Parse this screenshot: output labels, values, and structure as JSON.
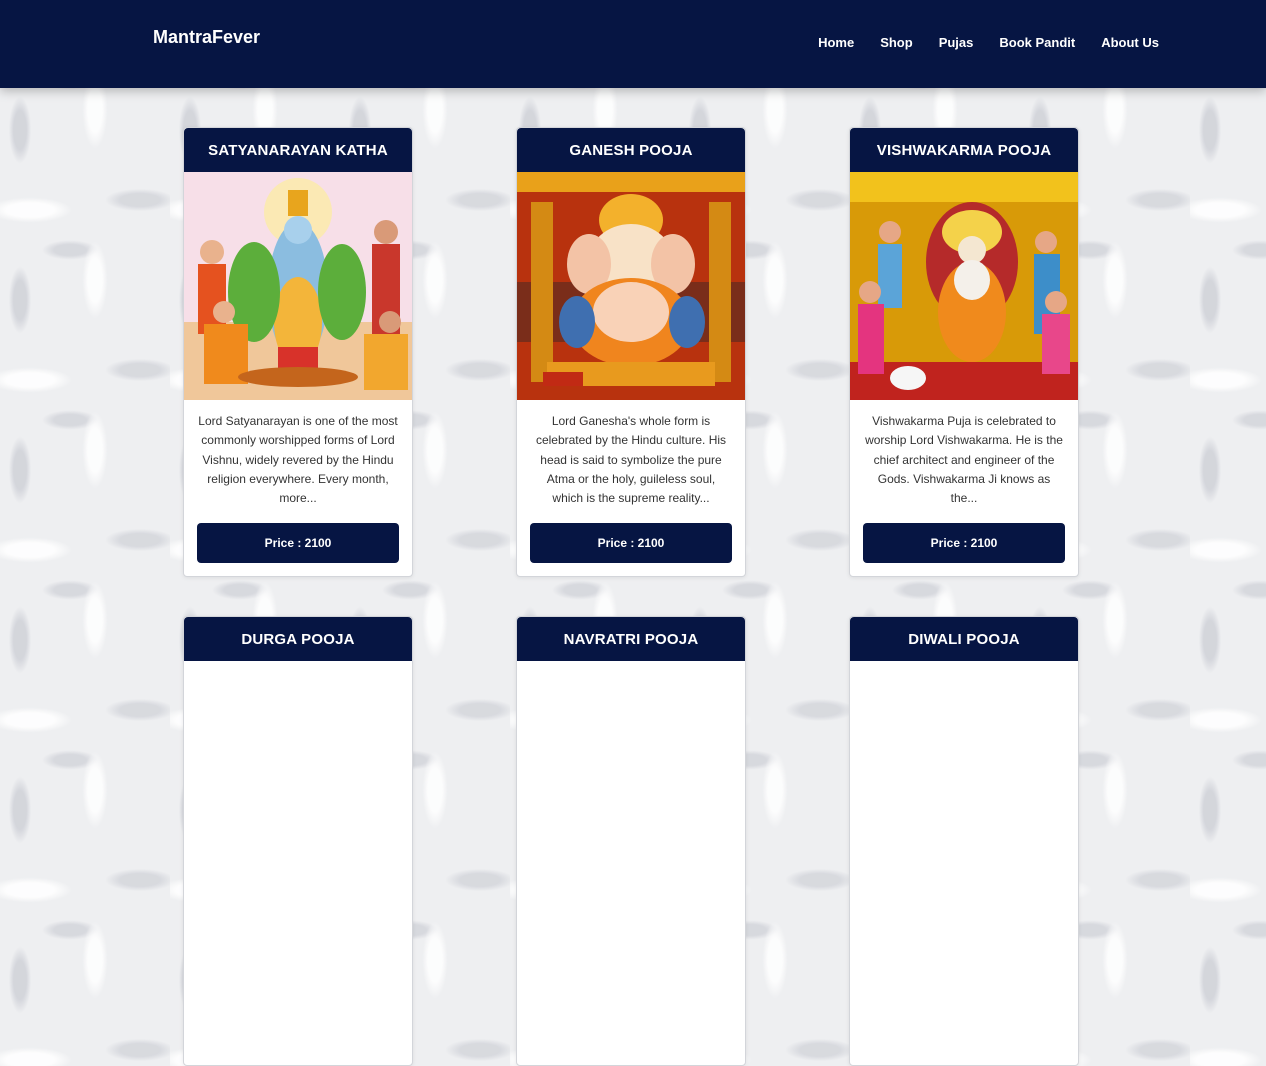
{
  "brand": "MantraFever",
  "nav": [
    "Home",
    "Shop",
    "Pujas",
    "Book Pandit",
    "About Us"
  ],
  "cards": [
    {
      "title": "SATYANARAYAN KATHA",
      "description": "Lord Satyanarayan is one of the most commonly worshipped forms of Lord Vishnu, widely revered by the Hindu religion everywhere. Every month, more...",
      "price": "Price : 2100",
      "image_colors": [
        "#f7dfe8",
        "#f3b53a",
        "#8bbde0"
      ]
    },
    {
      "title": "GANESH POOJA",
      "description": "Lord Ganesha's whole form is celebrated by the Hindu culture. His head is said to symbolize the pure Atma or the holy, guileless soul, which is the supreme reality...",
      "price": "Price : 2100",
      "image_colors": [
        "#b8320e",
        "#f5a418",
        "#f8e2c7"
      ]
    },
    {
      "title": "VISHWAKARMA POOJA",
      "description": "Vishwakarma Puja is celebrated to worship Lord Vishwakarma. He is the chief architect and engineer of the Gods. Vishwakarma Ji knows as the...",
      "price": "Price : 2100",
      "image_colors": [
        "#d89a08",
        "#c0231e",
        "#f4e7d1"
      ]
    },
    {
      "title": "DURGA POOJA"
    },
    {
      "title": "NAVRATRI POOJA"
    },
    {
      "title": "DIWALI POOJA"
    }
  ]
}
